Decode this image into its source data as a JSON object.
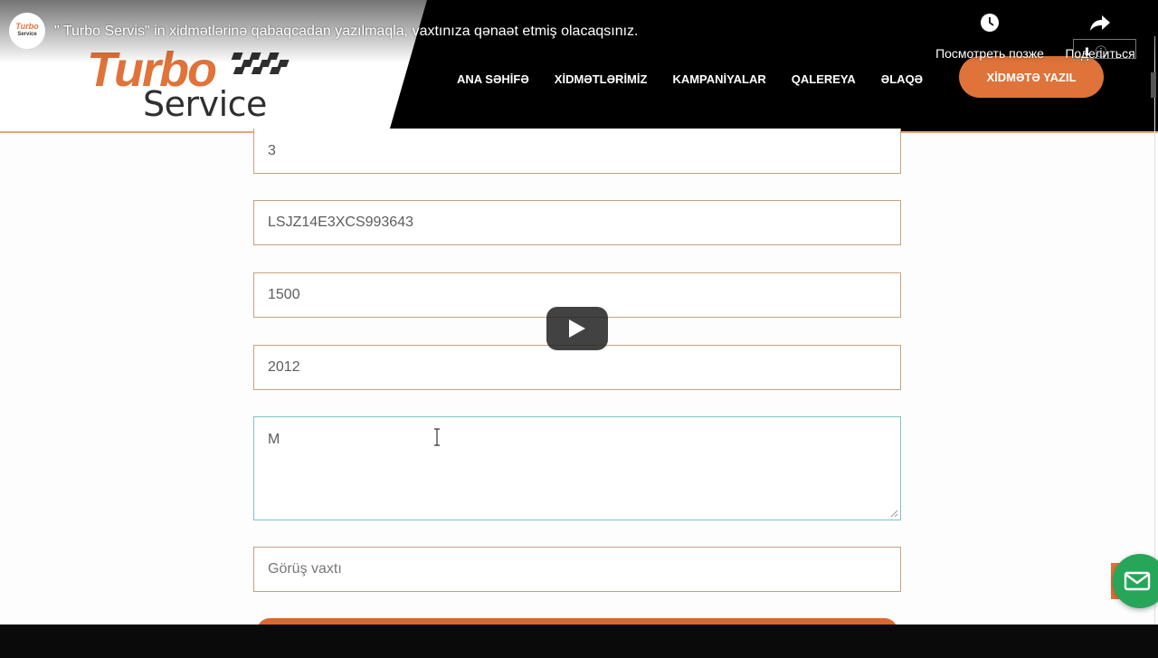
{
  "youtube": {
    "channel_avatar": {
      "line1": "Turbo",
      "line2": "Service"
    },
    "video_title": "\" Turbo Servis\" in xidmətlərinə qabaqcadan yazılmaqla, vaxtınıza qənaət etmiş olacaqsınız.",
    "watch_later_label": "Посмотреть позже",
    "share_label": "Поделиться",
    "icons": [
      "clock-icon",
      "share-arrow-icon",
      "play-icon"
    ]
  },
  "site": {
    "logo_turbo": "Turbo",
    "logo_service": "Service",
    "nav": [
      "ANA SƏHİFƏ",
      "XİDMƏTLƏRİMİZ",
      "KAMPANİYALAR",
      "QALEREYA",
      "ƏLAQƏ"
    ],
    "cta_label": "XİDMƏTƏ YAZIL"
  },
  "form": {
    "fields": [
      "3",
      "LSJZ14E3XCS993643",
      "1500",
      "2012"
    ],
    "textarea_value": "M",
    "appointment_placeholder": "Görüş vaxtı"
  },
  "colors": {
    "accent": "#df7339",
    "field_border": "#c8a27f",
    "focus_border": "#7fc4c7",
    "mail_button": "#27a65a"
  }
}
